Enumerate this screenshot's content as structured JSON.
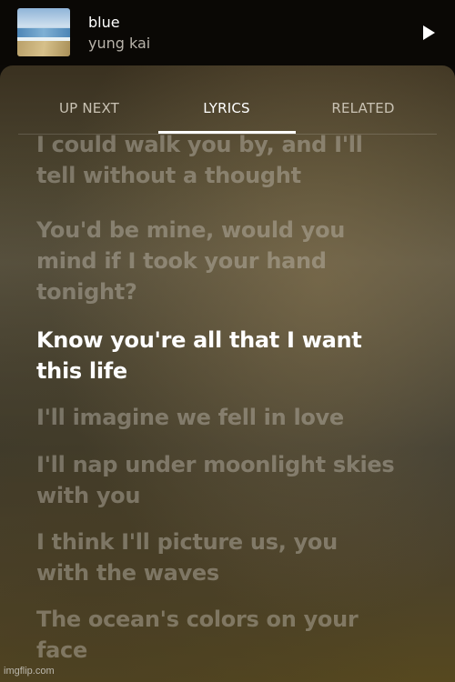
{
  "player": {
    "song_title": "blue",
    "artist": "yung kai",
    "play_icon": "play-icon"
  },
  "tabs": [
    {
      "label": "UP NEXT",
      "active": false
    },
    {
      "label": "LYRICS",
      "active": true
    },
    {
      "label": "RELATED",
      "active": false
    }
  ],
  "lyrics": [
    {
      "text": "I could walk you by, and I'll\ntell without a thought",
      "current": false
    },
    {
      "text": "You'd be mine, would you\nmind if I took your hand\ntonight?",
      "current": false
    },
    {
      "text": "Know you're all that I want\nthis life",
      "current": true
    },
    {
      "text": "I'll imagine we fell in love",
      "current": false
    },
    {
      "text": "I'll nap under moonlight skies\nwith you",
      "current": false
    },
    {
      "text": "I think I'll picture us, you\nwith the waves",
      "current": false
    },
    {
      "text": "The ocean's colors on your\nface",
      "current": false
    }
  ],
  "watermark": "imgflip.com"
}
